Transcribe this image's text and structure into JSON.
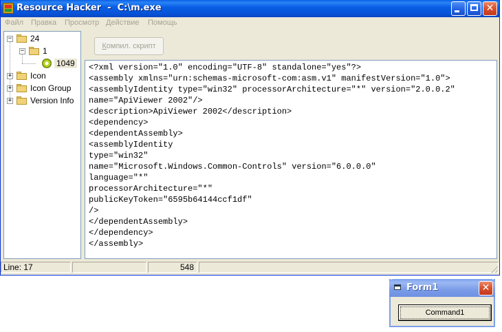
{
  "window": {
    "title": "Resource Hacker  -  C:\\m.exe",
    "close_glyph": "✕"
  },
  "menu": {
    "items": [
      {
        "label": "Файл"
      },
      {
        "label": "Правка"
      },
      {
        "label": "Просмотр"
      },
      {
        "label": "Действие"
      },
      {
        "label": "Помощь"
      }
    ]
  },
  "tree": {
    "nodes": [
      {
        "label": "24",
        "expander": "−",
        "icon": "folder-open-icon"
      },
      {
        "label": "1",
        "expander": "−",
        "icon": "folder-open-icon"
      },
      {
        "label": "1049",
        "icon": "resource-gear-icon",
        "selected": true
      },
      {
        "label": "Icon",
        "expander": "+",
        "icon": "folder-icon"
      },
      {
        "label": "Icon Group",
        "expander": "+",
        "icon": "folder-icon"
      },
      {
        "label": "Version Info",
        "expander": "+",
        "icon": "folder-icon"
      }
    ]
  },
  "toolbar": {
    "compile_label_u": "К",
    "compile_label_rest": "омпил. скрипт"
  },
  "editor": {
    "lines": [
      "<?xml version=\"1.0\" encoding=\"UTF-8\" standalone=\"yes\"?>",
      "<assembly xmlns=\"urn:schemas-microsoft-com:asm.v1\" manifestVersion=\"1.0\">",
      "<assemblyIdentity type=\"win32\" processorArchitecture=\"*\" version=\"2.0.0.2\"",
      "name=\"ApiViewer 2002\"/>",
      "<description>ApiViewer 2002</description>",
      "<dependency>",
      "<dependentAssembly>",
      "<assemblyIdentity",
      "type=\"win32\"",
      "name=\"Microsoft.Windows.Common-Controls\" version=\"6.0.0.0\"",
      "language=\"*\"",
      "processorArchitecture=\"*\"",
      "publicKeyToken=\"6595b64144ccf1df\"",
      "/>",
      "</dependentAssembly>",
      "</dependency>",
      "</assembly>"
    ]
  },
  "status": {
    "line": "Line: 17",
    "cell2": "",
    "size": "548",
    "cell4": ""
  },
  "form1": {
    "title": "Form1",
    "close_glyph": "✕",
    "button_label": "Command1"
  }
}
